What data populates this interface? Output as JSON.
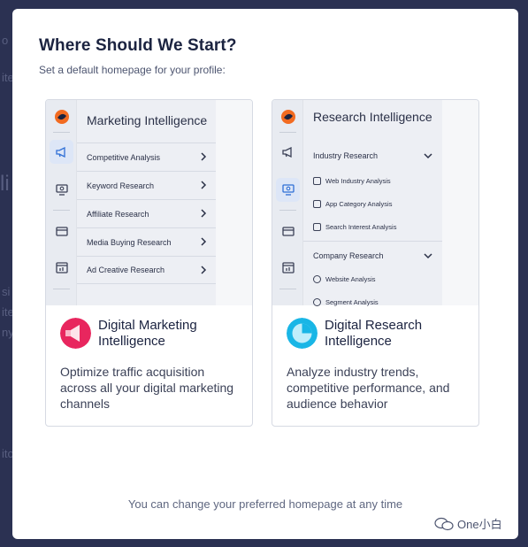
{
  "background": {
    "frag_1": "o",
    "frag_2": "ite",
    "frag_3": "li",
    "frag_4": "si",
    "frag_5": "ite",
    "frag_6": "ny",
    "frag_7": "ito"
  },
  "modal": {
    "title": "Where Should We Start?",
    "subtitle": "Set a default homepage for your profile:",
    "footer_note": "You can change your preferred homepage at any time"
  },
  "cards": [
    {
      "panel_title": "Marketing Intelligence",
      "menu": [
        "Competitive Analysis",
        "Keyword Research",
        "Affiliate Research",
        "Media Buying Research",
        "Ad Creative Research"
      ],
      "product_name": "Digital Marketing Intelligence",
      "description": "Optimize traffic acquisition across all your digital marketing channels",
      "accent": "#e8265e"
    },
    {
      "panel_title": "Research Intelligence",
      "section_1": "Industry Research",
      "section_1_items": [
        "Web Industry Analysis",
        "App Category Analysis",
        "Search Interest Analysis"
      ],
      "section_2": "Company Research",
      "section_2_items": [
        "Website Analysis",
        "Segment Analysis"
      ],
      "product_name": "Digital Research Intelligence",
      "description": "Analyze industry trends, competitive performance, and audience behavior",
      "accent": "#19b6e6"
    }
  ],
  "watermark": "One小白",
  "colors": {
    "backdrop": "#2b3152",
    "logo_orange": "#f26b21",
    "logo_navy": "#1b2340"
  }
}
